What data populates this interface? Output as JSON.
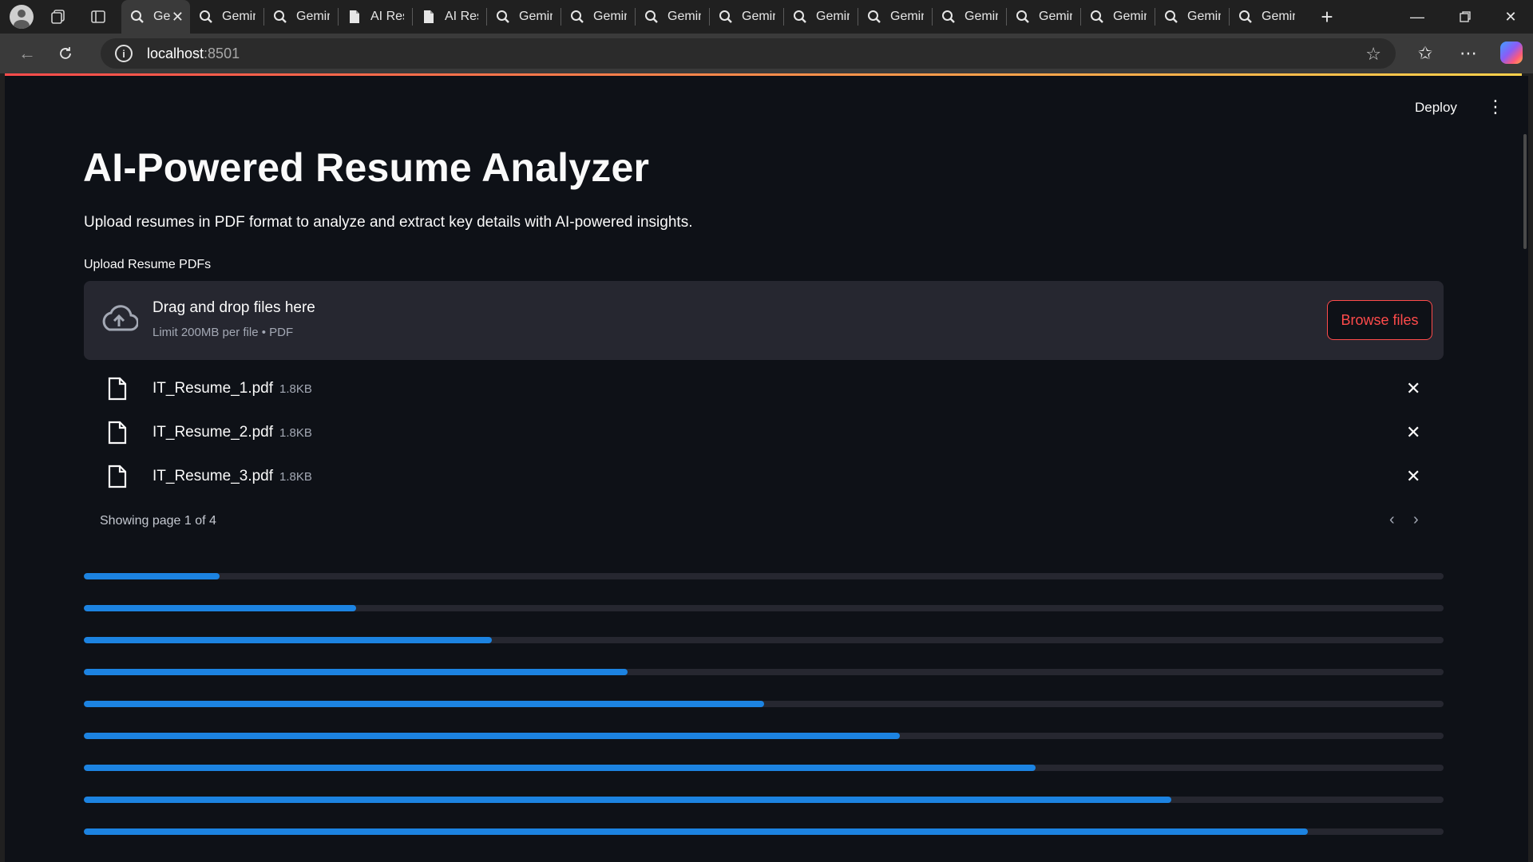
{
  "browser": {
    "tabs": [
      {
        "title": "Ge",
        "icon": "search-icon",
        "active": true
      },
      {
        "title": "Gemini",
        "icon": "search-icon"
      },
      {
        "title": "Gemini",
        "icon": "search-icon"
      },
      {
        "title": "AI Resu",
        "icon": "document-icon"
      },
      {
        "title": "AI Resu",
        "icon": "document-icon"
      },
      {
        "title": "Gemini",
        "icon": "search-icon"
      },
      {
        "title": "Gemini",
        "icon": "search-icon"
      },
      {
        "title": "Gemini",
        "icon": "search-icon"
      },
      {
        "title": "Gemini",
        "icon": "search-icon"
      },
      {
        "title": "Gemini",
        "icon": "search-icon"
      },
      {
        "title": "Gemini",
        "icon": "search-icon"
      },
      {
        "title": "Gemini",
        "icon": "search-icon"
      },
      {
        "title": "Gemini",
        "icon": "search-icon"
      },
      {
        "title": "Gemini",
        "icon": "search-icon"
      },
      {
        "title": "Gemini",
        "icon": "search-icon"
      },
      {
        "title": "Gemini",
        "icon": "search-icon"
      }
    ],
    "url_host": "localhost",
    "url_port": ":8501"
  },
  "app": {
    "deploy_label": "Deploy",
    "title": "AI-Powered Resume Analyzer",
    "subtitle": "Upload resumes in PDF format to analyze and extract key details with AI-powered insights.",
    "upload_label": "Upload Resume PDFs",
    "dropzone": {
      "title": "Drag and drop files here",
      "subtitle": "Limit 200MB per file • PDF",
      "browse_label": "Browse files"
    },
    "files": [
      {
        "name": "IT_Resume_1.pdf",
        "size": "1.8KB"
      },
      {
        "name": "IT_Resume_2.pdf",
        "size": "1.8KB"
      },
      {
        "name": "IT_Resume_3.pdf",
        "size": "1.8KB"
      }
    ],
    "pager_text": "Showing page 1 of 4",
    "progress_fractions": [
      0.1,
      0.2,
      0.3,
      0.4,
      0.5,
      0.6,
      0.7,
      0.8,
      0.9
    ]
  },
  "colors": {
    "accent": "#ff4b4b",
    "progress": "#1c83e1",
    "background": "#0e1117",
    "surface": "#262730"
  }
}
